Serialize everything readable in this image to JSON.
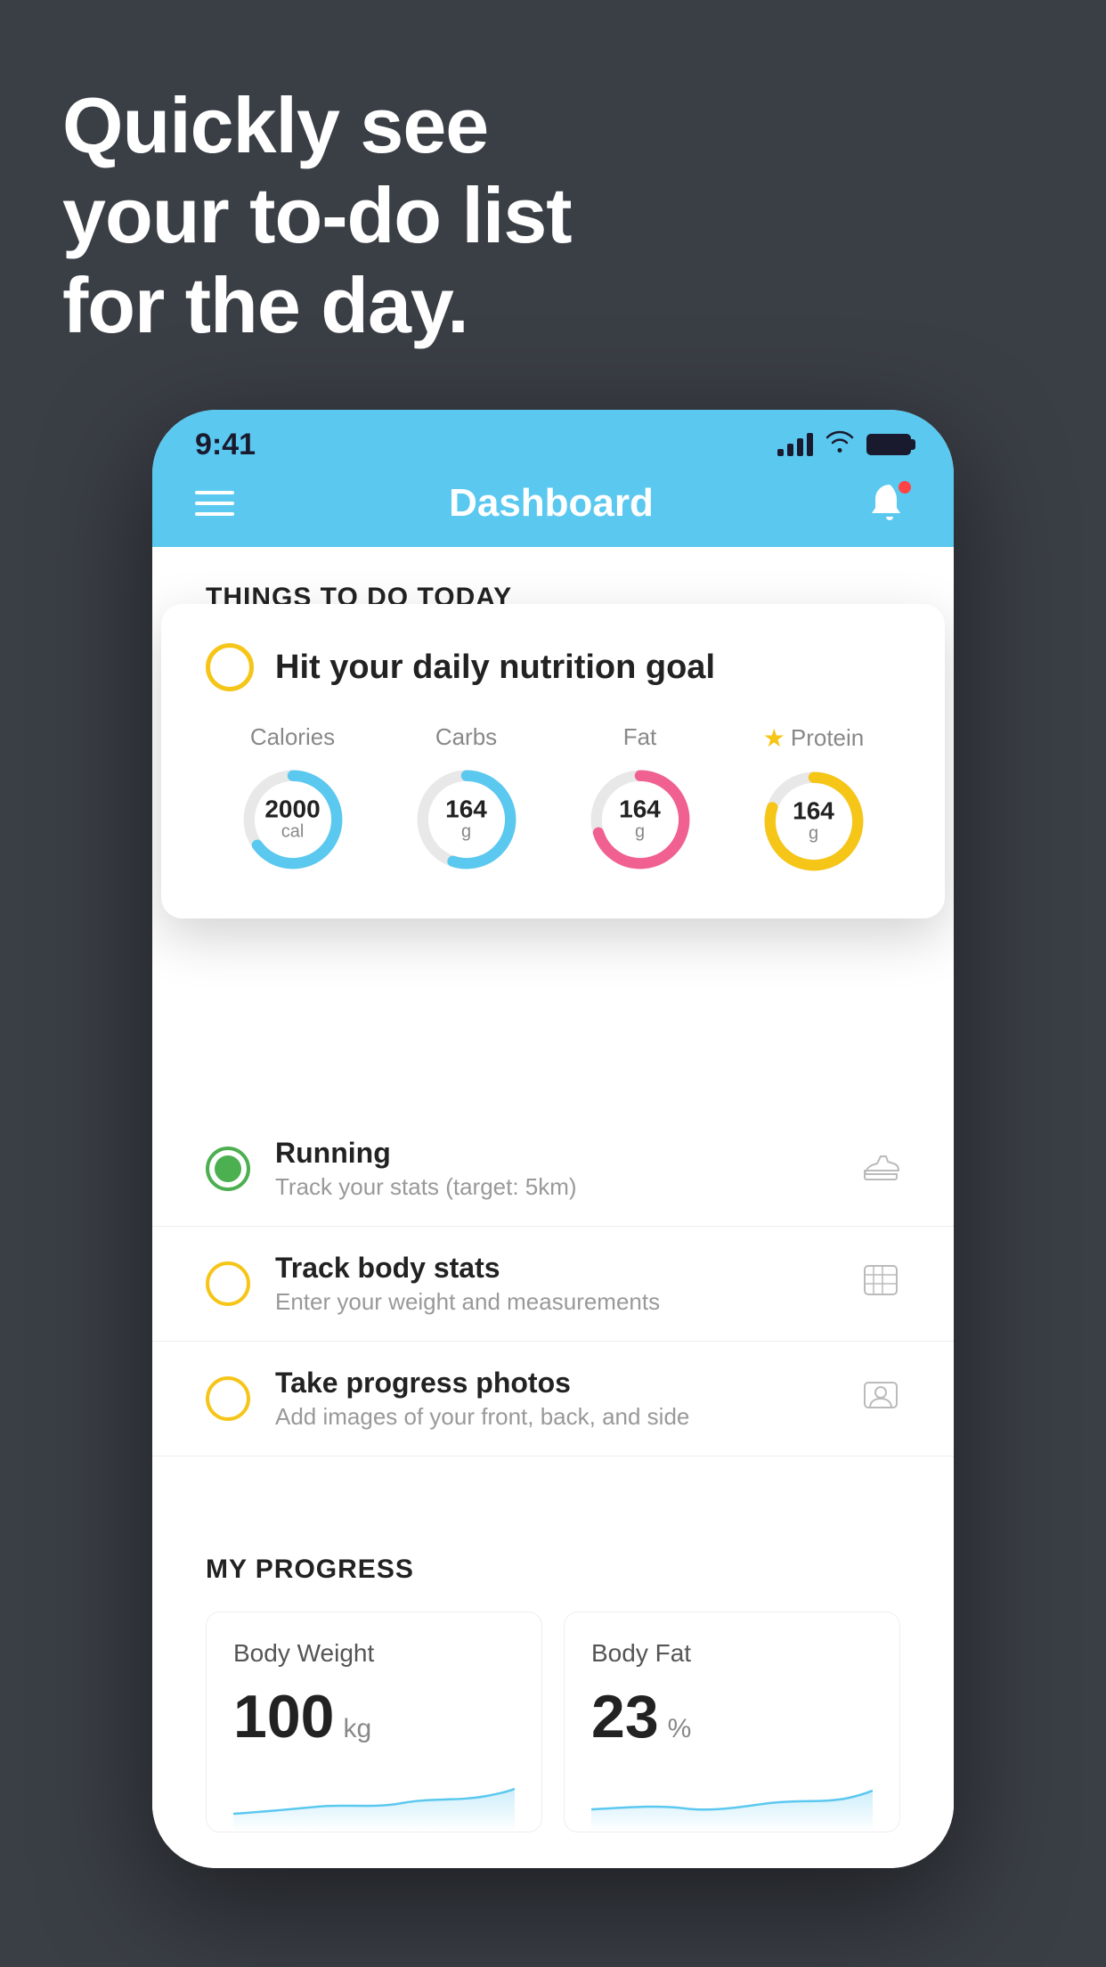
{
  "headline": {
    "line1": "Quickly see",
    "line2": "your to-do list",
    "line3": "for the day."
  },
  "status_bar": {
    "time": "9:41"
  },
  "nav": {
    "title": "Dashboard"
  },
  "things_section": {
    "title": "THINGS TO DO TODAY"
  },
  "floating_card": {
    "title": "Hit your daily nutrition goal",
    "nutrition": {
      "calories": {
        "label": "Calories",
        "value": "2000",
        "unit": "cal",
        "color": "#5bc8f0",
        "pct": 65
      },
      "carbs": {
        "label": "Carbs",
        "value": "164",
        "unit": "g",
        "color": "#5bc8f0",
        "pct": 55
      },
      "fat": {
        "label": "Fat",
        "value": "164",
        "unit": "g",
        "color": "#f06090",
        "pct": 70
      },
      "protein": {
        "label": "Protein",
        "value": "164",
        "unit": "g",
        "color": "#f5c518",
        "pct": 80
      }
    }
  },
  "todo_items": [
    {
      "title": "Running",
      "subtitle": "Track your stats (target: 5km)",
      "status": "done",
      "icon": "shoe"
    },
    {
      "title": "Track body stats",
      "subtitle": "Enter your weight and measurements",
      "status": "pending",
      "icon": "scale"
    },
    {
      "title": "Take progress photos",
      "subtitle": "Add images of your front, back, and side",
      "status": "pending",
      "icon": "person"
    }
  ],
  "progress": {
    "title": "MY PROGRESS",
    "body_weight": {
      "title": "Body Weight",
      "value": "100",
      "unit": "kg"
    },
    "body_fat": {
      "title": "Body Fat",
      "value": "23",
      "unit": "%"
    }
  }
}
